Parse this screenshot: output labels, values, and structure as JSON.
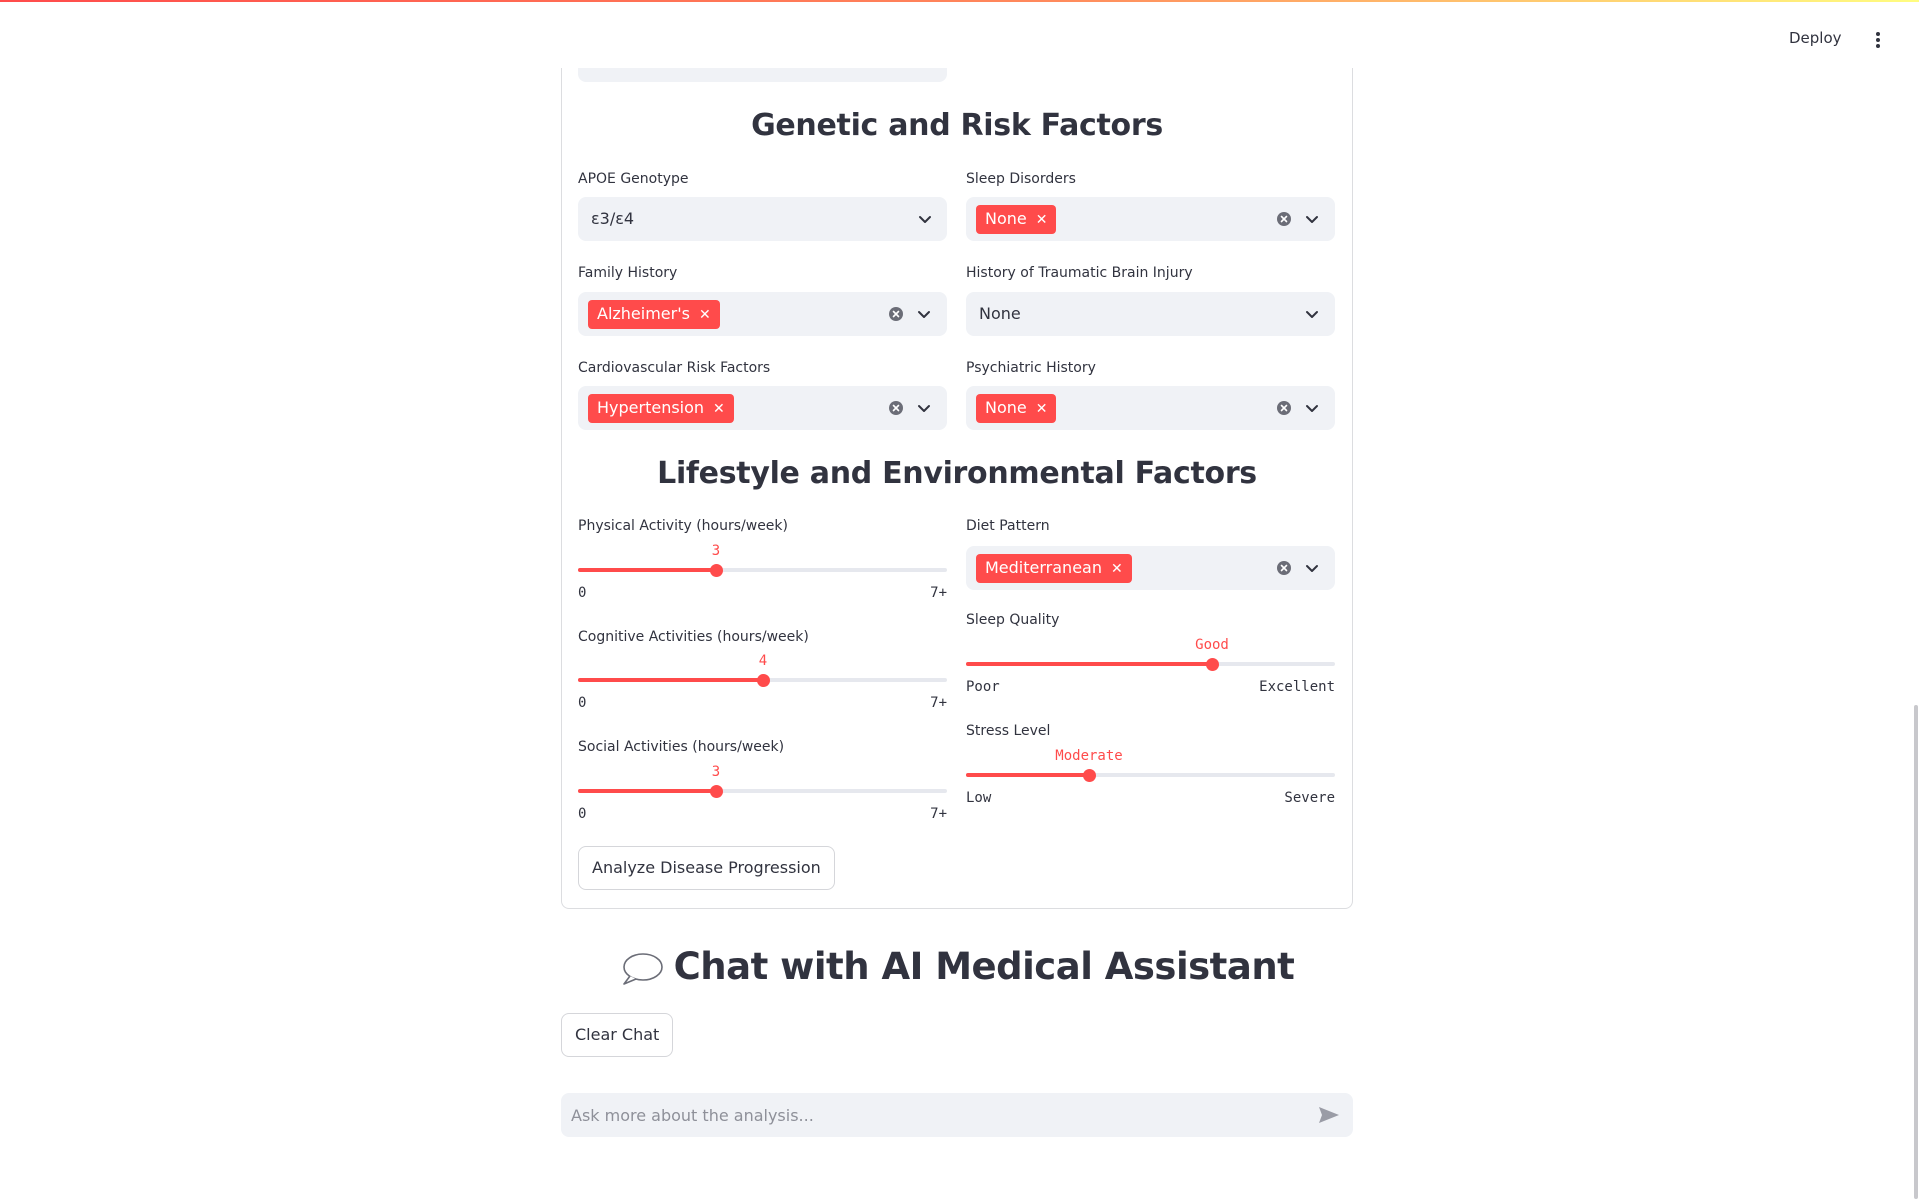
{
  "header": {
    "deploy_label": "Deploy",
    "menu_icon": "kebab-menu-icon"
  },
  "genetic": {
    "title": "Genetic and Risk Factors",
    "apoe": {
      "label": "APOE Genotype",
      "value": "ε3/ε4"
    },
    "sleep_disorders": {
      "label": "Sleep Disorders",
      "tags": [
        "None"
      ]
    },
    "family_history": {
      "label": "Family History",
      "tags": [
        "Alzheimer's"
      ]
    },
    "tbi": {
      "label": "History of Traumatic Brain Injury",
      "value": "None"
    },
    "cardio": {
      "label": "Cardiovascular Risk Factors",
      "tags": [
        "Hypertension"
      ]
    },
    "psych": {
      "label": "Psychiatric History",
      "tags": [
        "None"
      ]
    }
  },
  "lifestyle": {
    "title": "Lifestyle and Environmental Factors",
    "physical": {
      "label": "Physical Activity (hours/week)",
      "value": "3",
      "min": "0",
      "max": "7+",
      "fraction": 0.375
    },
    "cognitive": {
      "label": "Cognitive Activities (hours/week)",
      "value": "4",
      "min": "0",
      "max": "7+",
      "fraction": 0.5
    },
    "social": {
      "label": "Social Activities (hours/week)",
      "value": "3",
      "min": "0",
      "max": "7+",
      "fraction": 0.375
    },
    "diet": {
      "label": "Diet Pattern",
      "tags": [
        "Mediterranean"
      ]
    },
    "sleep_quality": {
      "label": "Sleep Quality",
      "value": "Good",
      "min": "Poor",
      "max": "Excellent",
      "fraction": 0.667
    },
    "stress": {
      "label": "Stress Level",
      "value": "Moderate",
      "min": "Low",
      "max": "Severe",
      "fraction": 0.333
    }
  },
  "analyze_button": "Analyze Disease Progression",
  "chat": {
    "title": "Chat with AI Medical Assistant",
    "clear_button": "Clear Chat",
    "placeholder": "Ask more about the analysis..."
  },
  "colors": {
    "accent": "#ff4b4b",
    "field_bg": "#f0f2f6",
    "text": "#31333f"
  }
}
